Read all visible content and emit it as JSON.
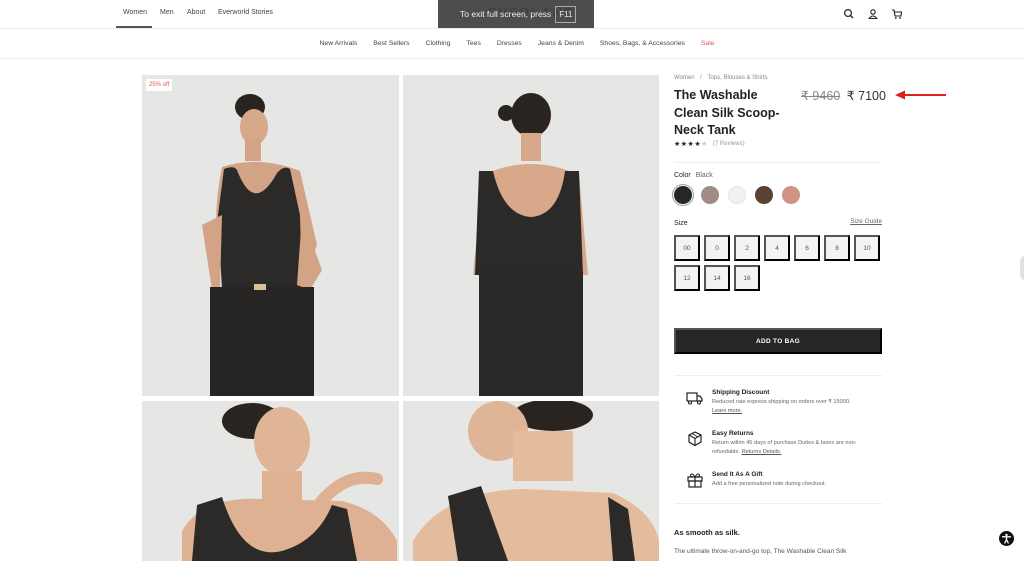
{
  "top_nav": {
    "items": [
      {
        "label": "Women",
        "active": true
      },
      {
        "label": "Men",
        "active": false
      },
      {
        "label": "About",
        "active": false
      },
      {
        "label": "Everworld Stories",
        "active": false
      }
    ],
    "brand_ghost": "EVERLANE",
    "icons": [
      "search-icon",
      "account-icon",
      "cart-icon"
    ]
  },
  "fullscreen_toast": {
    "message": "To exit full screen, press",
    "key": "F11"
  },
  "category_nav": {
    "items": [
      "New Arrivals",
      "Best Sellers",
      "Clothing",
      "Tees",
      "Dresses",
      "Jeans & Denim",
      "Shoes, Bags, & Accessories",
      "Sale"
    ]
  },
  "gallery": {
    "badge": "25% off",
    "images": [
      "front-view",
      "back-view",
      "detail-front",
      "detail-back"
    ]
  },
  "product": {
    "breadcrumb": [
      "Women",
      "Tops, Blouses & Shirts"
    ],
    "breadcrumb_separator": "/",
    "title": "The Washable Clean Silk Scoop-Neck Tank",
    "price_old": "₹ 9460",
    "price_new": "₹ 7100",
    "rating": {
      "value": 4,
      "max": 5,
      "reviews": "(7 Reviews)"
    },
    "color_label": "Color",
    "color_selected": "Black",
    "colors": [
      {
        "name": "Black",
        "hex": "#262626",
        "selected": true
      },
      {
        "name": "Taupe",
        "hex": "#a08c82",
        "selected": false
      },
      {
        "name": "Ivory",
        "hex": "#f1f1ee",
        "selected": false
      },
      {
        "name": "Brown",
        "hex": "#5a4233",
        "selected": false
      },
      {
        "name": "Rose",
        "hex": "#cf9484",
        "selected": false
      }
    ],
    "size_label": "Size",
    "size_guide": "Size Guide",
    "sizes": [
      "00",
      "0",
      "2",
      "4",
      "6",
      "8",
      "10",
      "12",
      "14",
      "16"
    ],
    "add_to_bag": "ADD TO BAG",
    "perks": [
      {
        "icon": "truck-icon",
        "title": "Shipping Discount",
        "desc": "Reduced rate express shipping on orders over ₹ 15000.",
        "link": "Learn more."
      },
      {
        "icon": "box-icon",
        "title": "Easy Returns",
        "desc": "Return within 45 days of purchase Duties & taxes are non-refundable.",
        "link": "Returns Details."
      },
      {
        "icon": "gift-icon",
        "title": "Send It As A Gift",
        "desc": "Add a free personalized note during checkout.",
        "link": ""
      }
    ],
    "tagline": "As smooth as silk.",
    "description": "The ultimate throw-on-and-go top, The Washable Clean Silk"
  },
  "colors": {
    "accent_sale": "#e15a5a",
    "annotation_arrow": "#e02020",
    "button_bg": "#262626"
  }
}
